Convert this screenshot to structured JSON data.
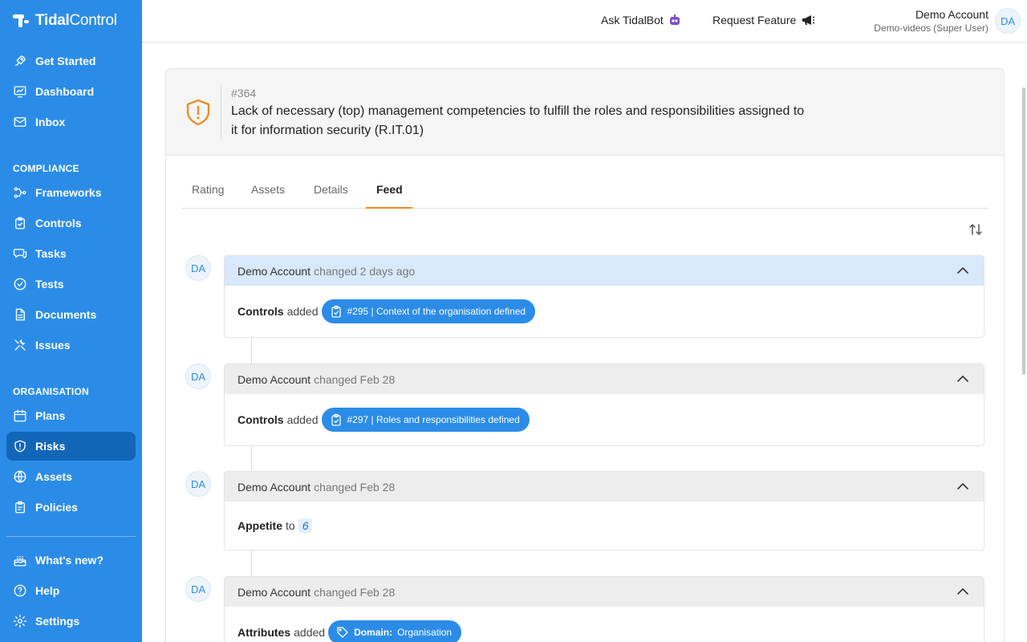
{
  "brand": {
    "name_bold": "Tidal",
    "name_light": "Control"
  },
  "sidebar": {
    "top_items": [
      {
        "label": "Get Started",
        "icon": "rocket-icon"
      },
      {
        "label": "Dashboard",
        "icon": "dashboard-icon"
      },
      {
        "label": "Inbox",
        "icon": "inbox-icon"
      }
    ],
    "compliance_label": "COMPLIANCE",
    "compliance_items": [
      {
        "label": "Frameworks",
        "icon": "frameworks-icon"
      },
      {
        "label": "Controls",
        "icon": "controls-icon"
      },
      {
        "label": "Tasks",
        "icon": "tasks-icon"
      },
      {
        "label": "Tests",
        "icon": "tests-icon"
      },
      {
        "label": "Documents",
        "icon": "documents-icon"
      },
      {
        "label": "Issues",
        "icon": "issues-icon"
      }
    ],
    "organisation_label": "ORGANISATION",
    "organisation_items": [
      {
        "label": "Plans",
        "icon": "calendar-icon"
      },
      {
        "label": "Risks",
        "icon": "shield-icon",
        "active": true
      },
      {
        "label": "Assets",
        "icon": "globe-icon"
      },
      {
        "label": "Policies",
        "icon": "policies-icon"
      }
    ],
    "bottom_items": [
      {
        "label": "What's new?",
        "icon": "cake-icon"
      },
      {
        "label": "Help",
        "icon": "help-icon"
      },
      {
        "label": "Settings",
        "icon": "gear-icon"
      }
    ]
  },
  "header": {
    "ask_bot": "Ask TidalBot",
    "request_feature": "Request Feature",
    "user_name": "Demo Account",
    "user_org": "Demo-videos (Super User)",
    "user_initials": "DA"
  },
  "risk": {
    "id": "#364",
    "title": "Lack of necessary (top) management competencies to fulfill the roles and responsibilities assigned to it for information security (R.IT.01)"
  },
  "tabs": [
    "Rating",
    "Assets",
    "Details",
    "Feed"
  ],
  "active_tab": "Feed",
  "feed": [
    {
      "initials": "DA",
      "who": "Demo Account",
      "action": "changed 2 days ago",
      "field": "Controls",
      "verb": "added",
      "pill": "#295 | Context of the organisation defined"
    },
    {
      "initials": "DA",
      "who": "Demo Account",
      "action": "changed Feb 28",
      "field": "Controls",
      "verb": "added",
      "pill": "#297 | Roles and responsibilities defined"
    },
    {
      "initials": "DA",
      "who": "Demo Account",
      "action": "changed Feb 28",
      "field": "Appetite",
      "verb": "to",
      "value": "6"
    },
    {
      "initials": "DA",
      "who": "Demo Account",
      "action": "changed Feb 28",
      "field": "Attributes",
      "verb": "added",
      "pill_key": "Domain:",
      "pill_value": "Organisation"
    }
  ],
  "colors": {
    "sidebar": "#2b8ce8",
    "active_nav": "#1266b8",
    "accent": "#f28a1d",
    "risk_icon": "#e8902b"
  }
}
